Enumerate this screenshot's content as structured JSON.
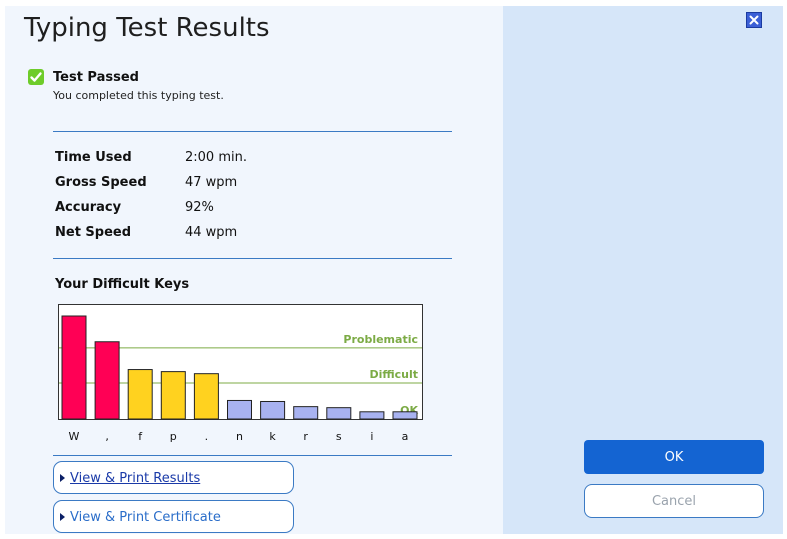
{
  "dialog": {
    "title": "Typing Test Results",
    "status": {
      "title": "Test Passed",
      "subtitle": "You completed this typing test.",
      "icon": "check-icon",
      "color": "#6ecc2a"
    },
    "stats": [
      {
        "label": "Time Used",
        "value": "2:00 min."
      },
      {
        "label": "Gross Speed",
        "value": "47 wpm"
      },
      {
        "label": "Accuracy",
        "value": "92%"
      },
      {
        "label": "Net Speed",
        "value": "44 wpm"
      }
    ],
    "difficult_keys_title": "Your Difficult Keys",
    "links": {
      "print_results": "View & Print Results",
      "print_certificate": "View & Print Certificate"
    },
    "buttons": {
      "ok": "OK",
      "cancel": "Cancel",
      "close_icon": "close-icon"
    },
    "colors": {
      "accent": "#1464d2",
      "problematic": "#ff0055",
      "difficult": "#ffd21f",
      "ok": "#a8b2f0",
      "zone_label": "#7cab45"
    }
  },
  "chart_data": {
    "type": "bar",
    "categories": [
      "W",
      ",",
      "f",
      "p",
      ".",
      "n",
      "k",
      "r",
      "s",
      "i",
      "a"
    ],
    "values": [
      100,
      75,
      48,
      46,
      44,
      18,
      17,
      12,
      11,
      7,
      7
    ],
    "levels": [
      "problematic",
      "problematic",
      "difficult",
      "difficult",
      "difficult",
      "ok",
      "ok",
      "ok",
      "ok",
      "ok",
      "ok"
    ],
    "zones": [
      {
        "label": "Problematic",
        "from": 69,
        "to": 100
      },
      {
        "label": "Difficult",
        "from": 35,
        "to": 69
      },
      {
        "label": "OK",
        "from": 0,
        "to": 35
      }
    ],
    "ylim": [
      0,
      100
    ],
    "grid": true
  }
}
